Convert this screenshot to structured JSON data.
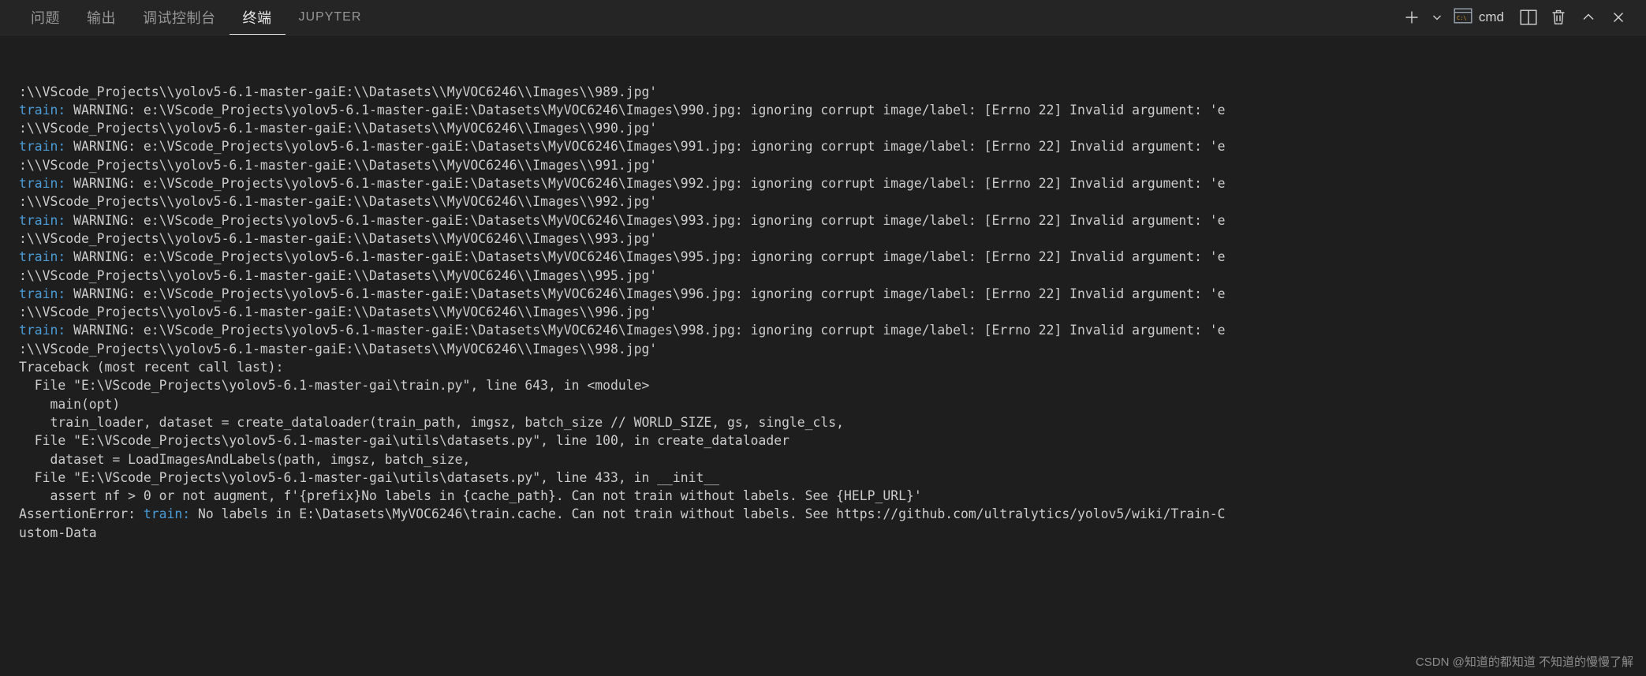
{
  "panel": {
    "tabs": [
      {
        "label": "问题",
        "active": false,
        "latin": false
      },
      {
        "label": "输出",
        "active": false,
        "latin": false
      },
      {
        "label": "调试控制台",
        "active": false,
        "latin": false
      },
      {
        "label": "终端",
        "active": true,
        "latin": false
      },
      {
        "label": "JUPYTER",
        "active": false,
        "latin": true
      }
    ],
    "actions": {
      "new_terminal": "plus-icon",
      "new_terminal_dropdown": "chevron-down-icon",
      "terminal_kind_icon": "cmd-prompt-icon",
      "terminal_kind_label": "cmd",
      "split_terminal": "split-panel-icon",
      "kill_terminal": "trash-icon",
      "maximize_panel": "chevron-up-icon",
      "close_panel": "close-icon"
    },
    "colors": {
      "header_bg": "#252526",
      "terminal_bg": "#1e1e1e",
      "tab_inactive": "#969696",
      "tab_active": "#e7e7e7",
      "text": "#cccccc",
      "accent_blue": "#4a9bd6",
      "watermark": "#8c8c8c"
    }
  },
  "terminal": {
    "lines": [
      {
        "segments": [
          {
            "text": ":\\\\VScode_Projects\\\\yolov5-6.1-master-gaiE:\\\\Datasets\\\\MyVOC6246\\\\Images\\\\989.jpg'",
            "cls": "tok-path"
          }
        ]
      },
      {
        "segments": [
          {
            "text": "train: ",
            "cls": "tok-train"
          },
          {
            "text": "WARNING: e:\\VScode_Projects\\yolov5-6.1-master-gaiE:\\Datasets\\MyVOC6246\\Images\\990.jpg: ignoring corrupt image/label: [Errno 22] Invalid argument: 'e",
            "cls": "tok-path"
          }
        ]
      },
      {
        "segments": [
          {
            "text": ":\\\\VScode_Projects\\\\yolov5-6.1-master-gaiE:\\\\Datasets\\\\MyVOC6246\\\\Images\\\\990.jpg'",
            "cls": "tok-path"
          }
        ]
      },
      {
        "segments": [
          {
            "text": "train: ",
            "cls": "tok-train"
          },
          {
            "text": "WARNING: e:\\VScode_Projects\\yolov5-6.1-master-gaiE:\\Datasets\\MyVOC6246\\Images\\991.jpg: ignoring corrupt image/label: [Errno 22] Invalid argument: 'e",
            "cls": "tok-path"
          }
        ]
      },
      {
        "segments": [
          {
            "text": ":\\\\VScode_Projects\\\\yolov5-6.1-master-gaiE:\\\\Datasets\\\\MyVOC6246\\\\Images\\\\991.jpg'",
            "cls": "tok-path"
          }
        ]
      },
      {
        "segments": [
          {
            "text": "train: ",
            "cls": "tok-train"
          },
          {
            "text": "WARNING: e:\\VScode_Projects\\yolov5-6.1-master-gaiE:\\Datasets\\MyVOC6246\\Images\\992.jpg: ignoring corrupt image/label: [Errno 22] Invalid argument: 'e",
            "cls": "tok-path"
          }
        ]
      },
      {
        "segments": [
          {
            "text": ":\\\\VScode_Projects\\\\yolov5-6.1-master-gaiE:\\\\Datasets\\\\MyVOC6246\\\\Images\\\\992.jpg'",
            "cls": "tok-path"
          }
        ]
      },
      {
        "segments": [
          {
            "text": "train: ",
            "cls": "tok-train"
          },
          {
            "text": "WARNING: e:\\VScode_Projects\\yolov5-6.1-master-gaiE:\\Datasets\\MyVOC6246\\Images\\993.jpg: ignoring corrupt image/label: [Errno 22] Invalid argument: 'e",
            "cls": "tok-path"
          }
        ]
      },
      {
        "segments": [
          {
            "text": ":\\\\VScode_Projects\\\\yolov5-6.1-master-gaiE:\\\\Datasets\\\\MyVOC6246\\\\Images\\\\993.jpg'",
            "cls": "tok-path"
          }
        ]
      },
      {
        "segments": [
          {
            "text": "train: ",
            "cls": "tok-train"
          },
          {
            "text": "WARNING: e:\\VScode_Projects\\yolov5-6.1-master-gaiE:\\Datasets\\MyVOC6246\\Images\\995.jpg: ignoring corrupt image/label: [Errno 22] Invalid argument: 'e",
            "cls": "tok-path"
          }
        ]
      },
      {
        "segments": [
          {
            "text": ":\\\\VScode_Projects\\\\yolov5-6.1-master-gaiE:\\\\Datasets\\\\MyVOC6246\\\\Images\\\\995.jpg'",
            "cls": "tok-path"
          }
        ]
      },
      {
        "segments": [
          {
            "text": "train: ",
            "cls": "tok-train"
          },
          {
            "text": "WARNING: e:\\VScode_Projects\\yolov5-6.1-master-gaiE:\\Datasets\\MyVOC6246\\Images\\996.jpg: ignoring corrupt image/label: [Errno 22] Invalid argument: 'e",
            "cls": "tok-path"
          }
        ]
      },
      {
        "segments": [
          {
            "text": ":\\\\VScode_Projects\\\\yolov5-6.1-master-gaiE:\\\\Datasets\\\\MyVOC6246\\\\Images\\\\996.jpg'",
            "cls": "tok-path"
          }
        ]
      },
      {
        "segments": [
          {
            "text": "train: ",
            "cls": "tok-train"
          },
          {
            "text": "WARNING: e:\\VScode_Projects\\yolov5-6.1-master-gaiE:\\Datasets\\MyVOC6246\\Images\\998.jpg: ignoring corrupt image/label: [Errno 22] Invalid argument: 'e",
            "cls": "tok-path"
          }
        ]
      },
      {
        "segments": [
          {
            "text": ":\\\\VScode_Projects\\\\yolov5-6.1-master-gaiE:\\\\Datasets\\\\MyVOC6246\\\\Images\\\\998.jpg'",
            "cls": "tok-path"
          }
        ]
      },
      {
        "segments": [
          {
            "text": "Traceback (most recent call last):",
            "cls": "tok-path"
          }
        ]
      },
      {
        "segments": [
          {
            "text": "  File \"E:\\VScode_Projects\\yolov5-6.1-master-gai\\train.py\", line 643, in <module>",
            "cls": "tok-path"
          }
        ]
      },
      {
        "segments": [
          {
            "text": "    main(opt)",
            "cls": "tok-path"
          }
        ]
      },
      {
        "segments": [
          {
            "text": "    train_loader, dataset = create_dataloader(train_path, imgsz, batch_size // WORLD_SIZE, gs, single_cls,",
            "cls": "tok-path"
          }
        ]
      },
      {
        "segments": [
          {
            "text": "  File \"E:\\VScode_Projects\\yolov5-6.1-master-gai\\utils\\datasets.py\", line 100, in create_dataloader",
            "cls": "tok-path"
          }
        ]
      },
      {
        "segments": [
          {
            "text": "    dataset = LoadImagesAndLabels(path, imgsz, batch_size,",
            "cls": "tok-path"
          }
        ]
      },
      {
        "segments": [
          {
            "text": "  File \"E:\\VScode_Projects\\yolov5-6.1-master-gai\\utils\\datasets.py\", line 433, in __init__",
            "cls": "tok-path"
          }
        ]
      },
      {
        "segments": [
          {
            "text": "    assert nf > 0 or not augment, f'{prefix}No labels in {cache_path}. Can not train without labels. See {HELP_URL}'",
            "cls": "tok-path"
          }
        ]
      },
      {
        "segments": [
          {
            "text": "AssertionError: ",
            "cls": "tok-path"
          },
          {
            "text": "train: ",
            "cls": "tok-train"
          },
          {
            "text": "No labels in E:\\Datasets\\MyVOC6246\\train.cache. Can not train without labels. See https://github.com/ultralytics/yolov5/wiki/Train-C",
            "cls": "tok-path"
          }
        ]
      },
      {
        "segments": [
          {
            "text": "ustom-Data",
            "cls": "tok-path"
          }
        ]
      }
    ],
    "watermark": "CSDN @知道的都知道 不知道的慢慢了解"
  }
}
